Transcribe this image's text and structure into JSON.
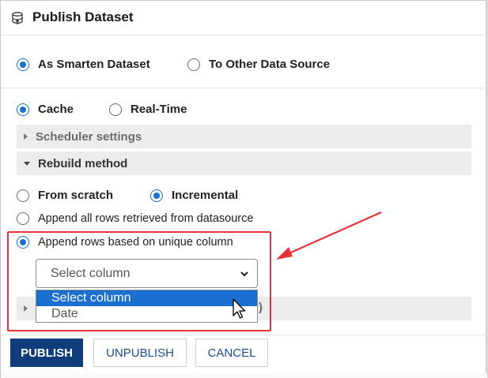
{
  "dialog": {
    "title": "Publish Dataset",
    "icon": "publish-dataset-icon"
  },
  "target": {
    "options": [
      {
        "label": "As Smarten Dataset",
        "checked": true
      },
      {
        "label": "To Other Data Source",
        "checked": false
      }
    ]
  },
  "mode": {
    "options": [
      {
        "label": "Cache",
        "checked": true
      },
      {
        "label": "Real-Time",
        "checked": false
      }
    ]
  },
  "accordions": {
    "scheduler": {
      "label": "Scheduler settings",
      "expanded": false
    },
    "rebuild": {
      "label": "Rebuild method",
      "expanded": true
    },
    "hidden_tail": ")"
  },
  "rebuild": {
    "options": [
      {
        "label": "From scratch",
        "checked": false
      },
      {
        "label": "Incremental",
        "checked": true
      },
      {
        "label": "Append all rows retrieved from datasource",
        "checked": false
      },
      {
        "label": "Append rows based on unique column",
        "checked": true
      }
    ]
  },
  "column_select": {
    "value": "Select column",
    "options": [
      "Select column",
      "Date"
    ],
    "highlighted": "Select column"
  },
  "buttons": {
    "publish": "PUBLISH",
    "unpublish": "UNPUBLISH",
    "cancel": "CANCEL"
  },
  "colors": {
    "accent": "#1a6fd1",
    "primary_button": "#0f3c7a",
    "annotation": "#e4343a"
  }
}
